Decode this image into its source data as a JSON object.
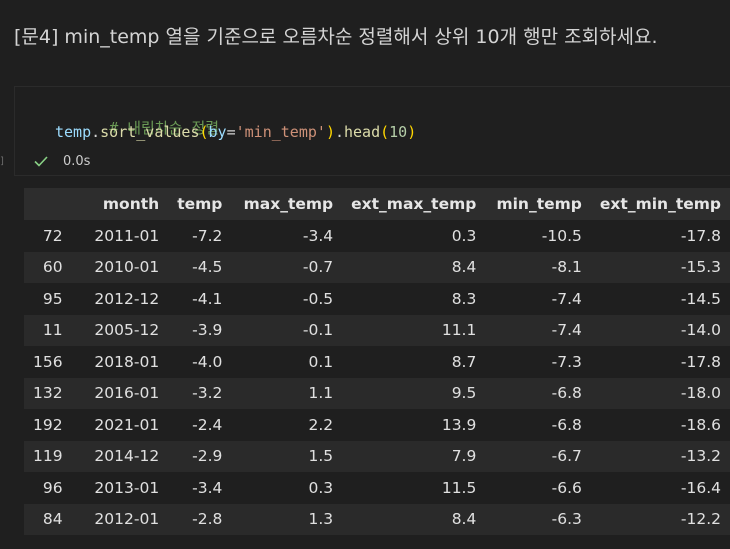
{
  "markdown": {
    "prompt": "[문4] min_temp 열을 기준으로 오름차순 정렬해서 상위 10개 행만 조회하세요."
  },
  "code_cell": {
    "comment": "# 내림차순 정렬",
    "var": "temp",
    "dot1": ".",
    "method1": "sort_values",
    "open1": "(",
    "param": "by",
    "eq": "=",
    "string": "'min_temp'",
    "close1": ")",
    "dot2": ".",
    "method2": "head",
    "open2": "(",
    "number": "10",
    "close2": ")",
    "exec_time": "0.0s",
    "cell_marker": "]"
  },
  "table": {
    "columns": [
      "",
      "month",
      "temp",
      "max_temp",
      "ext_max_temp",
      "min_temp",
      "ext_min_temp"
    ],
    "rows": [
      [
        "72",
        "2011-01",
        "-7.2",
        "-3.4",
        "0.3",
        "-10.5",
        "-17.8"
      ],
      [
        "60",
        "2010-01",
        "-4.5",
        "-0.7",
        "8.4",
        "-8.1",
        "-15.3"
      ],
      [
        "95",
        "2012-12",
        "-4.1",
        "-0.5",
        "8.3",
        "-7.4",
        "-14.5"
      ],
      [
        "11",
        "2005-12",
        "-3.9",
        "-0.1",
        "11.1",
        "-7.4",
        "-14.0"
      ],
      [
        "156",
        "2018-01",
        "-4.0",
        "0.1",
        "8.7",
        "-7.3",
        "-17.8"
      ],
      [
        "132",
        "2016-01",
        "-3.2",
        "1.1",
        "9.5",
        "-6.8",
        "-18.0"
      ],
      [
        "192",
        "2021-01",
        "-2.4",
        "2.2",
        "13.9",
        "-6.8",
        "-18.6"
      ],
      [
        "119",
        "2014-12",
        "-2.9",
        "1.5",
        "7.9",
        "-6.7",
        "-13.2"
      ],
      [
        "96",
        "2013-01",
        "-3.4",
        "0.3",
        "11.5",
        "-6.6",
        "-16.4"
      ],
      [
        "84",
        "2012-01",
        "-2.8",
        "1.3",
        "8.4",
        "-6.3",
        "-12.2"
      ]
    ]
  }
}
